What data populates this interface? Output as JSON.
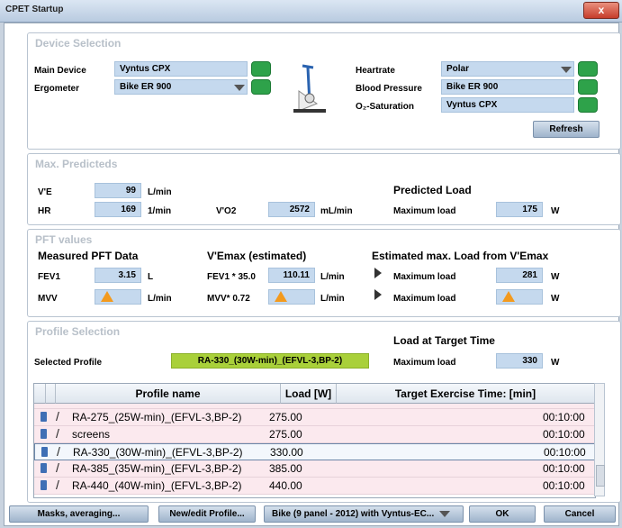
{
  "window": {
    "title": "CPET Startup",
    "close": "x"
  },
  "device": {
    "title": "Device Selection",
    "main_device_label": "Main Device",
    "main_device": "Vyntus CPX",
    "ergometer_label": "Ergometer",
    "ergometer": "Bike ER 900",
    "heartrate_label": "Heartrate",
    "heartrate": "Polar",
    "bp_label": "Blood Pressure",
    "bp": "Bike ER 900",
    "o2_label": "O₂-Saturation",
    "o2": "Vyntus CPX",
    "refresh": "Refresh"
  },
  "predicted": {
    "title": "Max. Predicteds",
    "ve_label": "V'E",
    "ve_value": "99",
    "ve_unit": "L/min",
    "hr_label": "HR",
    "hr_value": "169",
    "hr_unit": "1/min",
    "vo2_label": "V'O2",
    "vo2_value": "2572",
    "vo2_unit": "mL/min",
    "load_heading": "Predicted Load",
    "load_label": "Maximum load",
    "load_value": "175",
    "load_unit": "W"
  },
  "pft": {
    "title": "PFT values",
    "measured_heading": "Measured PFT Data",
    "fev1_label": "FEV1",
    "fev1_value": "3.15",
    "fev1_unit": "L",
    "mvv_label": "MVV",
    "mvv_unit": "L/min",
    "vemax_heading": "V'Emax (estimated)",
    "fev1x_label": "FEV1 * 35.0",
    "fev1x_value": "110.11",
    "fev1x_unit": "L/min",
    "mvvx_label": "MVV* 0.72",
    "mvvx_unit": "L/min",
    "est_heading": "Estimated max. Load from V'Emax",
    "est1_label": "Maximum load",
    "est1_value": "281",
    "est1_unit": "W",
    "est2_label": "Maximum load",
    "est2_unit": "W"
  },
  "profile": {
    "title": "Profile Selection",
    "selected_label": "Selected Profile",
    "selected_value": "RA-330_(30W-min)_(EFVL-3,BP-2)",
    "target_heading": "Load at Target Time",
    "target_label": "Maximum load",
    "target_value": "330",
    "target_unit": "W",
    "columns": [
      "Profile name",
      "Load [W]",
      "Target Exercise Time: [min]"
    ],
    "rows": [
      {
        "name": "RA-275_(25W-min)_(EFVL-3,BP-2)",
        "load": "275.00",
        "time": "00:10:00"
      },
      {
        "name": "screens",
        "load": "275.00",
        "time": "00:10:00"
      },
      {
        "name": "RA-330_(30W-min)_(EFVL-3,BP-2)",
        "load": "330.00",
        "time": "00:10:00"
      },
      {
        "name": "RA-385_(35W-min)_(EFVL-3,BP-2)",
        "load": "385.00",
        "time": "00:10:00"
      },
      {
        "name": "RA-440_(40W-min)_(EFVL-3,BP-2)",
        "load": "440.00",
        "time": "00:10:00"
      }
    ]
  },
  "footer": {
    "masks": "Masks, averaging...",
    "new_profile": "New/edit Profile...",
    "layout_select": "Bike (9 panel - 2012) with Vyntus-EC...",
    "ok": "OK",
    "cancel": "Cancel"
  },
  "colors": {
    "field": "#c5d9ee",
    "selected_profile": "#a9d03a",
    "table_row": "#fbe9ee",
    "green_button": "#2ea24a",
    "warning": "#f39a1e"
  }
}
